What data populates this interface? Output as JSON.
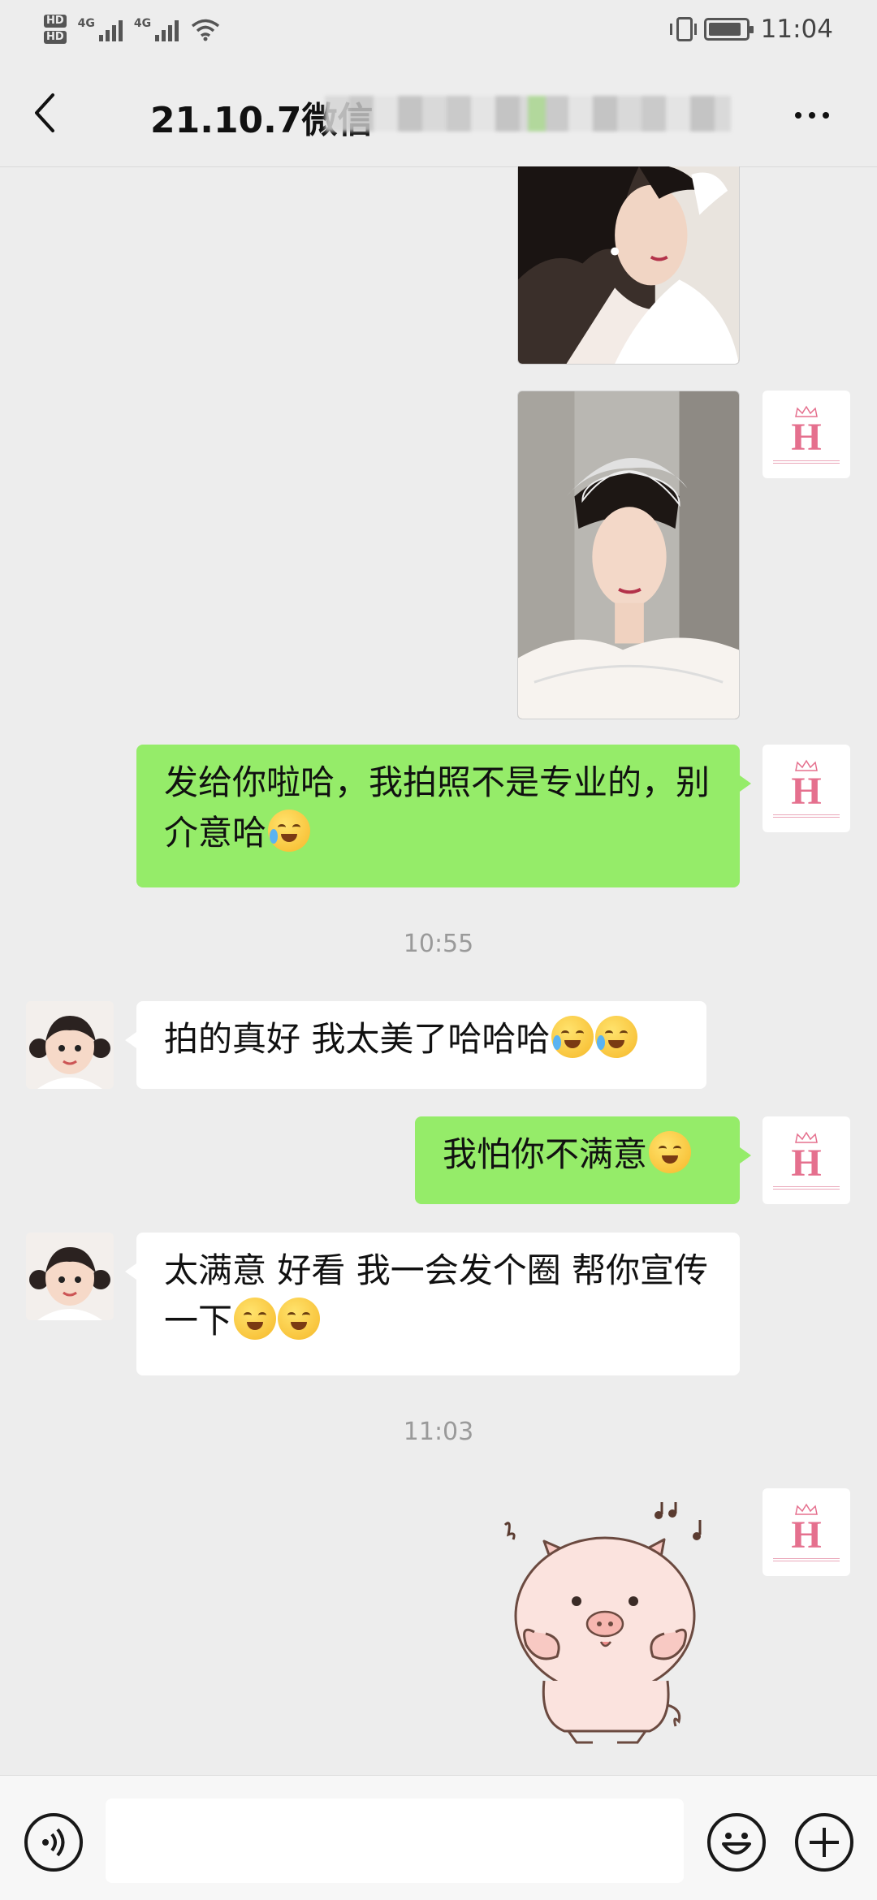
{
  "status_bar": {
    "network_1": "4G",
    "network_2": "4G",
    "hd_1": "HD",
    "hd_2": "HD",
    "battery_level": 0.9,
    "time": "11:04",
    "icons": [
      "hd-icon",
      "signal-icon",
      "wifi-icon",
      "vibrate-icon",
      "battery-icon"
    ]
  },
  "nav": {
    "title": "21.10.7微信",
    "back_icon": "chevron-left-icon",
    "more_icon": "more-dots-icon"
  },
  "messages": [
    {
      "type": "image",
      "from": "me",
      "alt": "portrait photo 1"
    },
    {
      "type": "image",
      "from": "me",
      "alt": "portrait photo 2"
    },
    {
      "type": "text",
      "from": "me",
      "text": "发给你啦哈，我拍照不是专业的，别介意哈",
      "emoji": "sweat-laugh-emoji"
    },
    {
      "type": "time",
      "text": "10:55"
    },
    {
      "type": "text",
      "from": "other",
      "text": "拍的真好 我太美了哈哈哈",
      "emoji": "laugh-cry-emoji"
    },
    {
      "type": "text",
      "from": "me",
      "text": "我怕你不满意",
      "emoji": "thinking-emoji"
    },
    {
      "type": "text",
      "from": "other",
      "text": "太满意 好看 我一会发个圈 帮你宣传一下",
      "emoji": "cool-emoji"
    },
    {
      "type": "time",
      "text": "11:03"
    },
    {
      "type": "sticker",
      "from": "me",
      "alt": "pink pig sticker"
    }
  ],
  "logo_avatar": {
    "letter": "H"
  },
  "input_bar": {
    "placeholder": "",
    "voice_icon": "voice-icon",
    "emoji_icon": "emoji-icon",
    "plus_icon": "plus-icon"
  },
  "colors": {
    "background": "#ededed",
    "me_bubble": "#95ec69",
    "other_bubble": "#ffffff",
    "logo_pink": "#e5708e"
  }
}
